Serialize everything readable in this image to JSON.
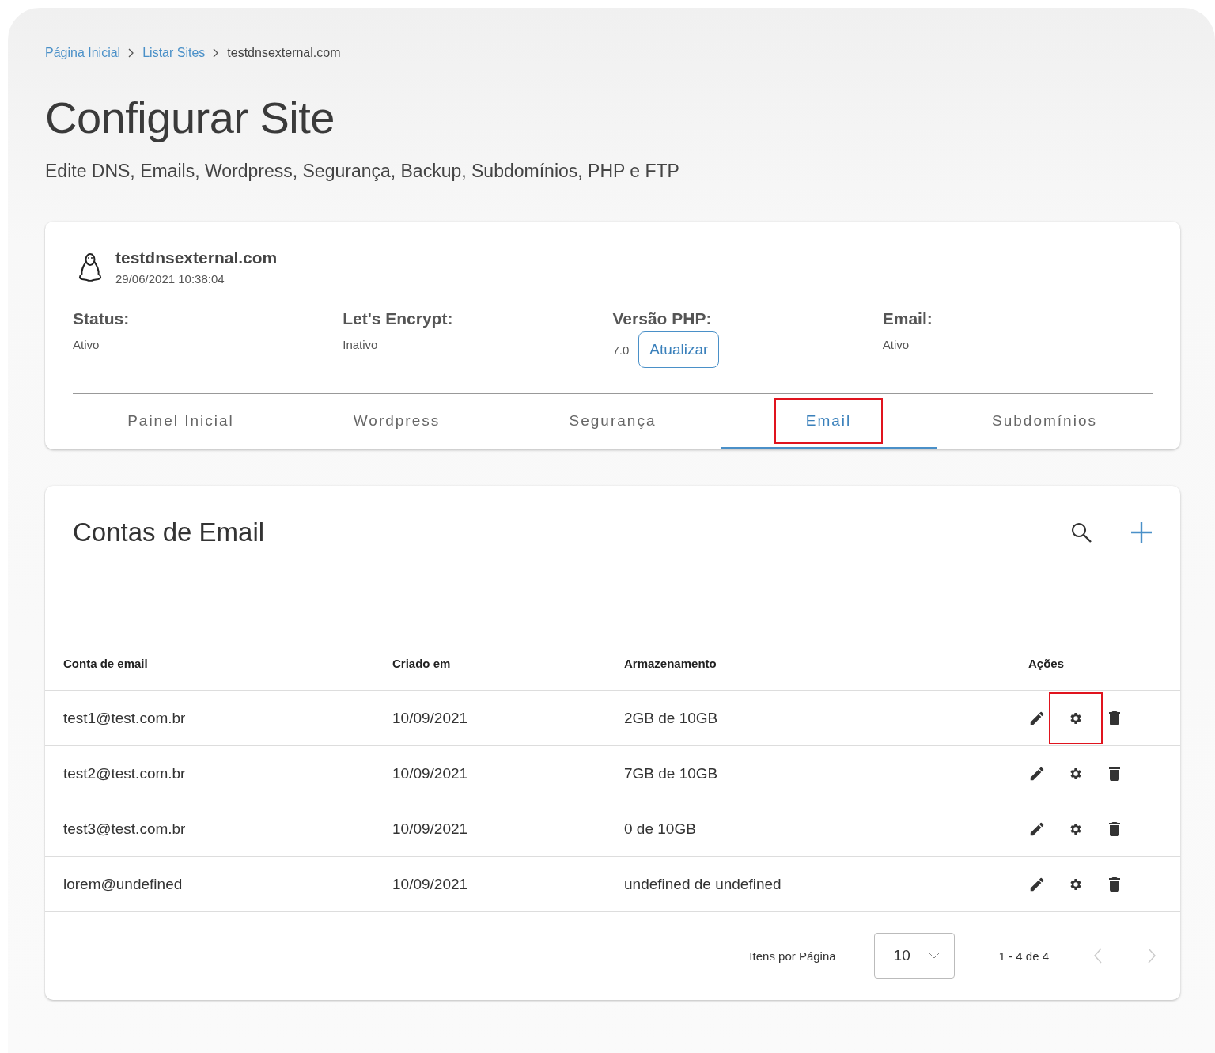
{
  "breadcrumb": [
    {
      "label": "Página Inicial",
      "link": true
    },
    {
      "label": "Listar Sites",
      "link": true
    },
    {
      "label": "testdnsexternal.com",
      "link": false
    }
  ],
  "page": {
    "title": "Configurar Site",
    "subtitle": "Edite DNS, Emails, Wordpress, Segurança, Backup, Subdomínios, PHP e FTP"
  },
  "site": {
    "domain": "testdnsexternal.com",
    "created": "29/06/2021 10:38:04",
    "info": [
      {
        "label": "Status:",
        "value": "Ativo"
      },
      {
        "label": "Let's Encrypt:",
        "value": "Inativo"
      },
      {
        "label": "Versão PHP:",
        "value": "7.0",
        "button": "Atualizar"
      },
      {
        "label": "Email:",
        "value": "Ativo"
      }
    ]
  },
  "tabs": [
    {
      "label": "Painel Inicial",
      "selected": false,
      "highlighted": false
    },
    {
      "label": "Wordpress",
      "selected": false,
      "highlighted": false
    },
    {
      "label": "Segurança",
      "selected": false,
      "highlighted": false
    },
    {
      "label": "Email",
      "selected": true,
      "highlighted": true
    },
    {
      "label": "Subdomínios",
      "selected": false,
      "highlighted": false
    }
  ],
  "accounts": {
    "title": "Contas de Email",
    "columns": [
      "Conta de email",
      "Criado em",
      "Armazenamento",
      "Ações"
    ],
    "rows": [
      {
        "account": "test1@test.com.br",
        "created": "10/09/2021",
        "storage": "2GB de 10GB",
        "settings_highlighted": true
      },
      {
        "account": "test2@test.com.br",
        "created": "10/09/2021",
        "storage": "7GB de 10GB",
        "settings_highlighted": false
      },
      {
        "account": "test3@test.com.br",
        "created": "10/09/2021",
        "storage": "0 de 10GB",
        "settings_highlighted": false
      },
      {
        "account": "lorem@undefined",
        "created": "10/09/2021",
        "storage": "undefined de undefined",
        "settings_highlighted": false
      }
    ],
    "pagination": {
      "label": "Itens por Página",
      "page_size": "10",
      "range": "1 - 4 de 4",
      "prev_disabled": true,
      "next_disabled": true
    }
  }
}
